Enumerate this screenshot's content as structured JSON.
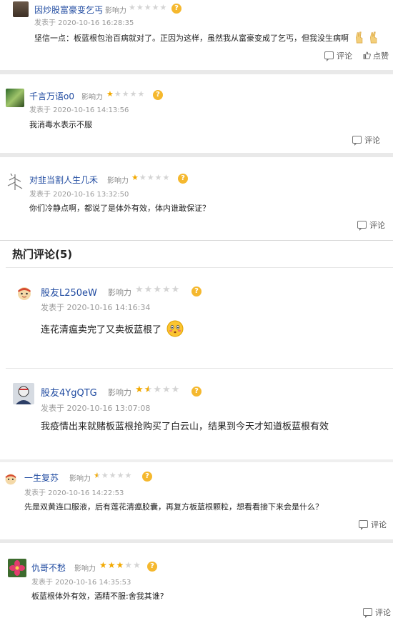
{
  "influence_label": "影响力",
  "comment_label": "评论",
  "like_label": "点赞",
  "hot_section": {
    "title": "热门评论(5)"
  },
  "comments": [
    {
      "user": "因炒股富豪变乞丐",
      "rating": 0,
      "time": "发表于 2020-10-16 16:28:35",
      "text": "坚信一点：板蓝根包治百病就对了。正因为这样，虽然我从富豪变成了乞丐，但我没生病啊"
    },
    {
      "user": "千言万语o0",
      "rating": 1,
      "time": "发表于 2020-10-16 14:13:56",
      "text": "我消毒水表示不服"
    },
    {
      "user": "对韭当割人生几禾",
      "rating": 1,
      "time": "发表于 2020-10-16 13:32:50",
      "text": "你们冷静点啊，都说了是体外有效，体内谁敢保证？"
    }
  ],
  "hot_comments": [
    {
      "user": "股友L250eW",
      "rating": 0,
      "time": "发表于 2020-10-16 14:16:34",
      "text": "连花清瘟卖完了又卖板蓝根了"
    },
    {
      "user": "股友4YgQTG",
      "rating": 1.5,
      "time": "发表于 2020-10-16 13:07:08",
      "text": "我疫情出来就赌板蓝根抢购买了白云山，结果到今天才知道板蓝根有效"
    },
    {
      "user": "一生复苏",
      "rating": 0.5,
      "time": "发表于 2020-10-16 14:22:53",
      "text": "先是双黄连口服液，后有莲花清瘟胶囊，再复方板蓝根颗粒，想看看接下来会是什么？"
    },
    {
      "user": "仇哥不愁",
      "rating": 3,
      "time": "发表于 2020-10-16 14:35:53",
      "text": "板蓝根体外有效，酒精不服:舍我其谁?"
    }
  ]
}
